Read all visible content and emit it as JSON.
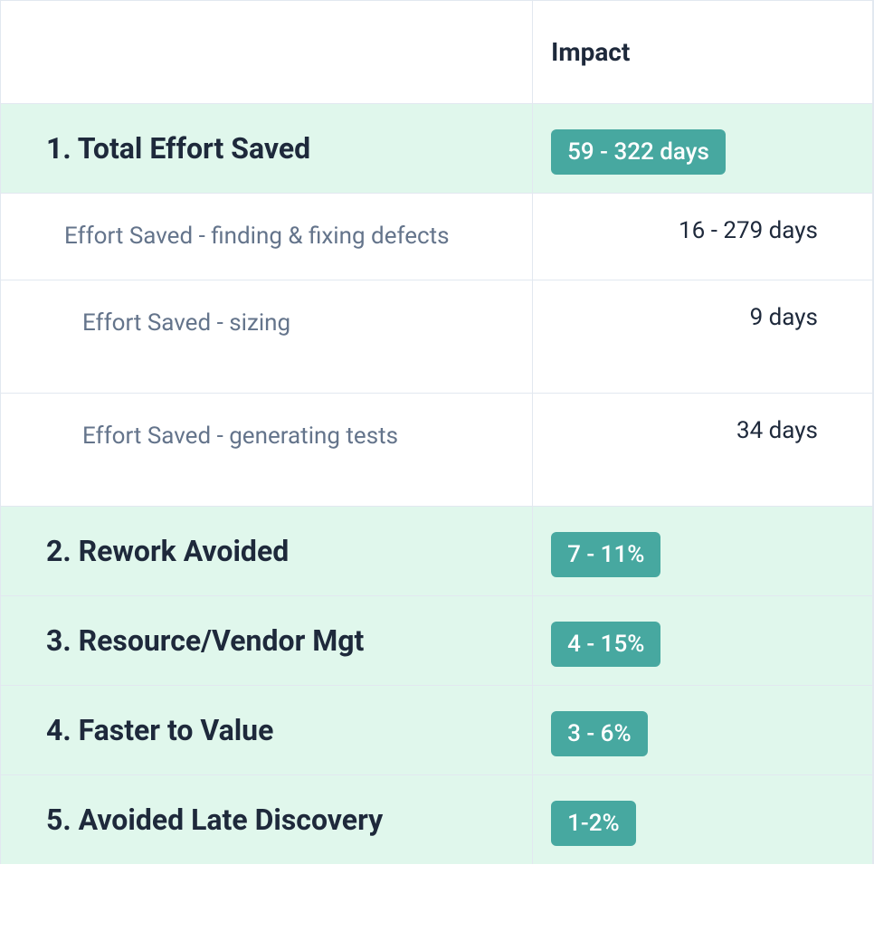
{
  "header": {
    "impact": "Impact"
  },
  "rows": [
    {
      "label": "1. Total Effort Saved",
      "impact": "59 - 322 days",
      "type": "main"
    },
    {
      "label": "Effort Saved - finding & fixing defects",
      "impact": "16 - 279 days",
      "type": "sub"
    },
    {
      "label": "Effort Saved - sizing",
      "impact": "9 days",
      "type": "subdeep"
    },
    {
      "label": "Effort Saved - generating tests",
      "impact": "34 days",
      "type": "subdeep"
    },
    {
      "label": "2. Rework Avoided",
      "impact": "7 - 11%",
      "type": "main"
    },
    {
      "label": "3. Resource/Vendor Mgt",
      "impact": "4 - 15%",
      "type": "main"
    },
    {
      "label": "4. Faster to Value",
      "impact": "3 - 6%",
      "type": "main"
    },
    {
      "label": "5. Avoided Late Discovery",
      "impact": "1-2%",
      "type": "main"
    }
  ]
}
